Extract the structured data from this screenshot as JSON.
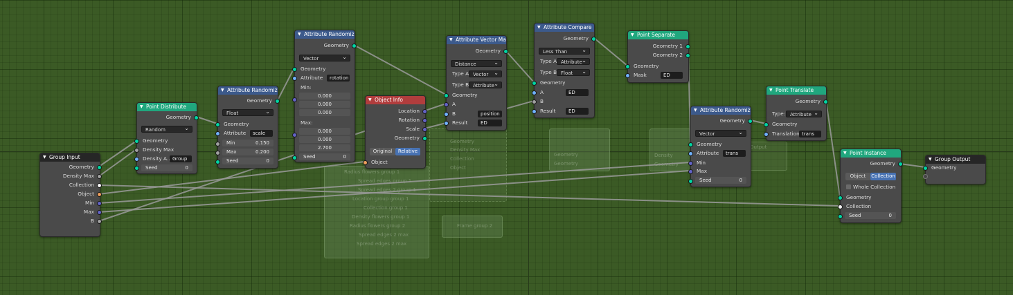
{
  "editor": {
    "name": "Geometry Node Editor"
  },
  "colors": {
    "background": "#3b5a25",
    "geometry_socket": "#00d6a3",
    "vector_socket": "#6363c7",
    "float_socket": "#a1a1a1",
    "object_socket": "#ed9e5c",
    "attribute_header": "#3c5a8c",
    "point_header": "#20a77e",
    "input_header": "#b13d3d"
  },
  "group_input": {
    "title": "Group Input",
    "outputs": [
      "Geometry",
      "Density Max",
      "Collection",
      "Object",
      "Min",
      "Max",
      "B"
    ]
  },
  "point_distribute": {
    "title": "Point Distribute",
    "out": "Geometry",
    "mode": "Random",
    "in_geometry": "Geometry",
    "density_max": "Density Max",
    "density_attr_label": "Density A...",
    "density_attr_value": "Group",
    "seed_label": "Seed",
    "seed_value": "0"
  },
  "attr_rand_1": {
    "title": "Attribute Randomize",
    "out": "Geometry",
    "type": "Float",
    "in_geometry": "Geometry",
    "attr_label": "Attribute",
    "attr_value": "scale",
    "min_label": "Min",
    "min_value": "0.150",
    "max_label": "Max",
    "max_value": "0.200",
    "seed_label": "Seed",
    "seed_value": "0"
  },
  "attr_rand_2": {
    "title": "Attribute Randomize",
    "out": "Geometry",
    "type": "Vector",
    "in_geometry": "Geometry",
    "attr_label": "Attribute",
    "attr_value": "rotation",
    "min_label": "Min:",
    "min_values": [
      "0.000",
      "0.000",
      "0.000"
    ],
    "max_label": "Max:",
    "max_values": [
      "0.000",
      "0.000",
      "2.700"
    ],
    "seed_label": "Seed",
    "seed_value": "0"
  },
  "object_info": {
    "title": "Object Info",
    "outputs": [
      "Location",
      "Rotation",
      "Scale",
      "Geometry"
    ],
    "original": "Original",
    "relative": "Relative",
    "in_object": "Object"
  },
  "attr_vec_math": {
    "title": "Attribute Vector Math",
    "out": "Geometry",
    "operation": "Distance",
    "type_a_label": "Type A:",
    "type_a": "Vector",
    "type_b_label": "Type B:",
    "type_b": "Attribute",
    "in_geometry": "Geometry",
    "in_a": "A",
    "in_b": "B",
    "b_value": "position",
    "result_label": "Result",
    "result_value": "ED"
  },
  "attr_compare": {
    "title": "Attribute Compare",
    "out": "Geometry",
    "operation": "Less Than",
    "type_a_label": "Type A:",
    "type_a": "Attribute",
    "type_b_label": "Type B:",
    "type_b": "Float",
    "in_geometry": "Geometry",
    "in_a": "A",
    "a_value": "ED",
    "in_b": "B",
    "result_label": "Result",
    "result_value": "ED"
  },
  "point_separate": {
    "title": "Point Separate",
    "out1": "Geometry 1",
    "out2": "Geometry 2",
    "in_geometry": "Geometry",
    "mask_label": "Mask",
    "mask_value": "ED"
  },
  "attr_rand_3": {
    "title": "Attribute Randomize",
    "out": "Geometry",
    "type": "Vector",
    "in_geometry": "Geometry",
    "attr_label": "Attribute",
    "attr_value": "trans",
    "min_label": "Min",
    "max_label": "Max",
    "seed_label": "Seed",
    "seed_value": "0"
  },
  "point_translate": {
    "title": "Point Translate",
    "out": "Geometry",
    "type_label": "Type:",
    "type": "Attribute",
    "in_geometry": "Geometry",
    "translation_label": "Translation",
    "translation_value": "trans"
  },
  "point_instance": {
    "title": "Point Instance",
    "out": "Geometry",
    "object": "Object",
    "collection": "Collection",
    "whole_collection": "Whole Collection",
    "in_geometry": "Geometry",
    "in_collection": "Collection",
    "seed_label": "Seed",
    "seed_value": "0"
  },
  "group_output": {
    "title": "Group Output",
    "in_geometry": "Geometry"
  },
  "ghost": {
    "labels": [
      "Radius flowers group 1",
      "Spread edges group 1",
      "Spread edges 2 group 1",
      "Location group group 1",
      "Collection group 1",
      "Density flowers group 1",
      "Radius flowers group 2",
      "Spread edges 2 max",
      "Spread edges 2 max"
    ],
    "node_labels": [
      "Geometry",
      "Density Max",
      "Collection",
      "Object",
      "Geometry",
      "Geometry",
      "Geometry",
      "Geometry",
      "Geometry",
      "Density",
      "Output"
    ],
    "group_label": "Frame group 2"
  }
}
